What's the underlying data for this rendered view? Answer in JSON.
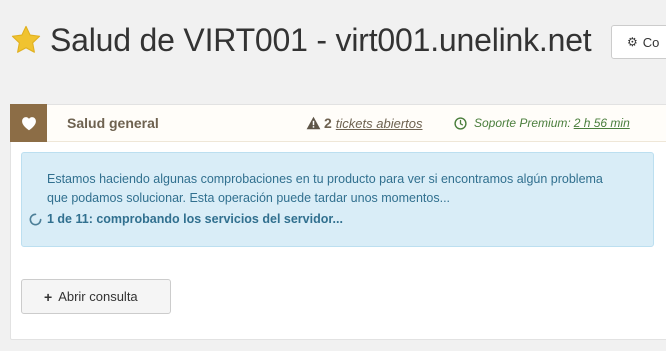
{
  "header": {
    "title": "Salud de VIRT001 - virt001.unelink.net",
    "config_button_label": "Co"
  },
  "panel": {
    "section_title": "Salud general",
    "tickets": {
      "count": "2",
      "label": "tickets abiertos"
    },
    "support": {
      "label": "Soporte Premium:",
      "time": "2 h 56 min"
    }
  },
  "alert": {
    "message": "Estamos haciendo algunas comprobaciones en tu producto para ver si encontramos algún problema que podamos solucionar. Esta operación puede tardar unos momentos...",
    "progress": "1 de 11: comprobando los servicios del servidor..."
  },
  "actions": {
    "open_ticket_label": "Abrir consulta"
  },
  "colors": {
    "accent_brown": "#8c6d46",
    "star_yellow": "#f0c330",
    "alert_bg": "#d9edf7",
    "alert_text": "#31708f",
    "support_green": "#4a7e3c"
  },
  "icons": [
    "star-icon",
    "gear-icon",
    "heart-icon",
    "warning-icon",
    "clock-icon",
    "spinner-icon",
    "plus-icon"
  ]
}
